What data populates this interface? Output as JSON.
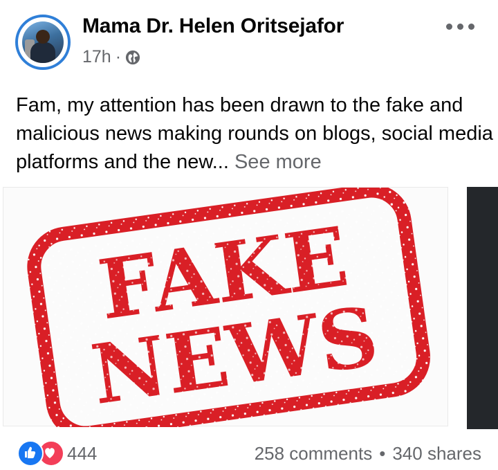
{
  "post": {
    "author": "Mama Dr.  Helen Oritsejafor",
    "time": "17h",
    "meta_dot": "·",
    "text": "Fam, my attention has been drawn to the fake and malicious news making rounds on blogs, social media platforms and the new...",
    "see_more": "See more"
  },
  "image": {
    "stamp_line1": "FAKE",
    "stamp_line2": "NEWS",
    "stamp_color": "#d91f26"
  },
  "footer": {
    "reactions_count": "444",
    "comments": "258 comments",
    "separator": "•",
    "shares": "340 shares"
  },
  "colors": {
    "accent_blue": "#1877f2",
    "love_red": "#f33e58",
    "secondary_text": "#65676b"
  },
  "icons": [
    "globe-icon",
    "more-options-icon",
    "like-reaction-icon",
    "love-reaction-icon"
  ]
}
